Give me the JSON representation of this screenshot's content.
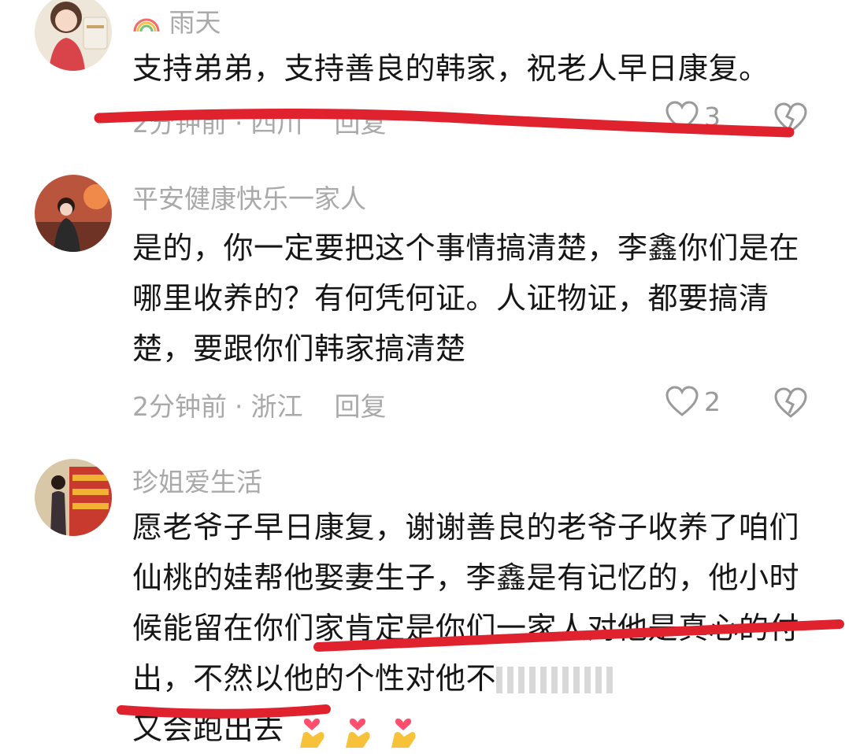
{
  "comments": [
    {
      "username": "雨天",
      "username_prefix_icon": "rainbow-icon",
      "content": "支持弟弟，支持善良的韩家，祝老人早日康复。",
      "time": "2分钟前",
      "location": "四川",
      "reply_label": "回复",
      "like_count": "3"
    },
    {
      "username": "平安健康快乐一家人",
      "content": "是的，你一定要把这个事情搞清楚，李鑫你们是在哪里收养的？有何凭何证。人证物证，都要搞清楚，要跟你们韩家搞清楚",
      "time": "2分钟前",
      "location": "浙江",
      "reply_label": "回复",
      "like_count": "2"
    },
    {
      "username": "珍姐爱生活",
      "content": "愿老爷子早日康复，谢谢善良的老爷子收养了咱们仙桃的娃帮他娶妻生子，李鑫是有记忆的，他小时候能留在你们家肯定是你们一家人对他是真心的付出，不然以他的个性对他不",
      "content_tail": "又会跑出去",
      "emojis": [
        "finger-heart-icon",
        "finger-heart-icon",
        "finger-heart-icon"
      ]
    }
  ],
  "separator": "·",
  "colors": {
    "annotation_red": "#e0222e",
    "meta_gray": "#a9a9a9",
    "text": "#161616"
  }
}
